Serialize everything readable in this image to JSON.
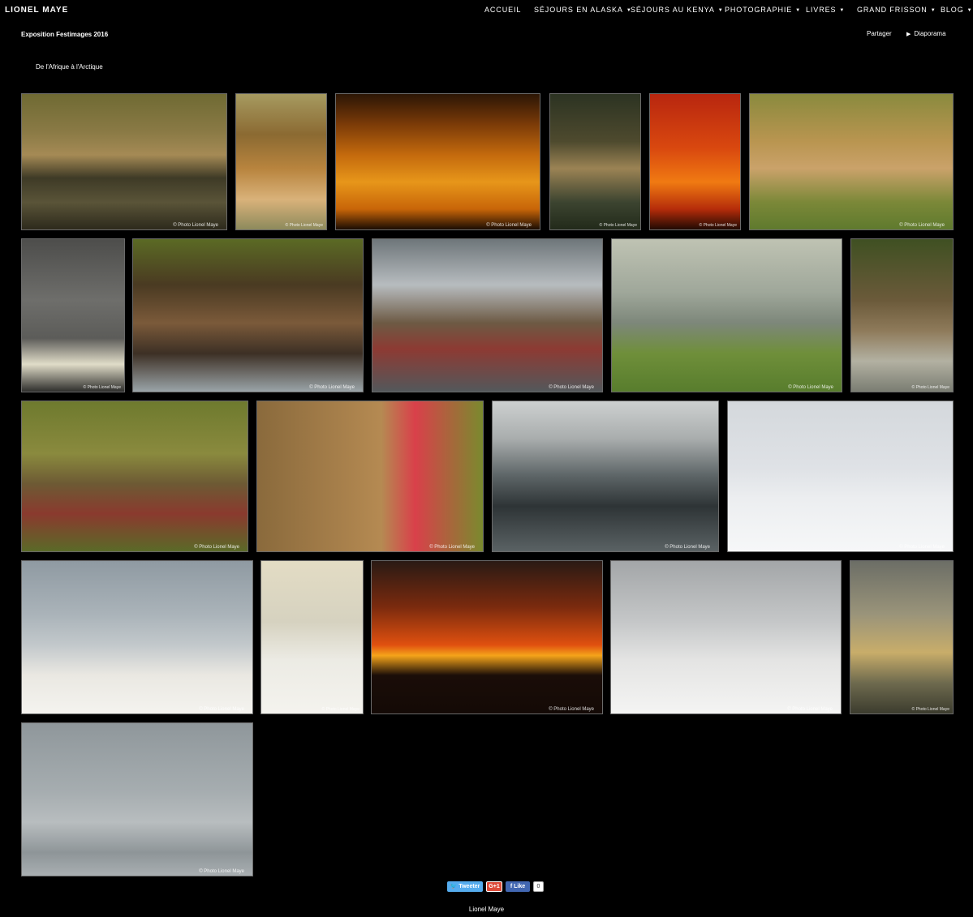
{
  "site": {
    "title": "LIONEL MAYE"
  },
  "nav": [
    {
      "label": "ACCUEIL",
      "caret": ""
    },
    {
      "label": "SÉJOURS EN ALASKA",
      "caret": "▼"
    },
    {
      "label": "SÉJOURS AU KENYA",
      "caret": "▼"
    },
    {
      "label": "PHOTOGRAPHIE",
      "caret": "▼"
    },
    {
      "label": "LIVRES",
      "caret": "▼"
    },
    {
      "label": "GRAND FRISSON",
      "caret": "▼"
    },
    {
      "label": "BLOG",
      "caret": "▼"
    }
  ],
  "gallery": {
    "title": "Exposition Festimages 2016",
    "subtitle": "De l'Afrique à l'Arctique",
    "share_label": "Partager",
    "slideshow_label": "Diaporama",
    "slideshow_icon": "play-icon",
    "watermark": "© Photo Lionel Maye",
    "photos": [
      {
        "name": "cheetahs-drinking",
        "bg": "linear-gradient(180deg,#6f6a33 0%,#8a7a45 28%,#a58a55 45%,#3e3a26 62%,#5a5438 80%,#2d2a1c 100%)"
      },
      {
        "name": "lion-roaring",
        "bg": "linear-gradient(180deg,#a69a60 0%,#8b6a32 30%,#b8843e 55%,#d9b27a 78%,#8d8a5c 100%)"
      },
      {
        "name": "elephant-sunset",
        "bg": "linear-gradient(180deg,#2c1605 0%,#7a3a08 22%,#c46a0d 45%,#e7961a 65%,#c86508 85%,#1a0c03 100%)"
      },
      {
        "name": "leopard-tree",
        "bg": "linear-gradient(180deg,#2c3322 0%,#4e4a2e 35%,#9b8354 55%,#3c4430 80%,#222a1a 100%)"
      },
      {
        "name": "giraffe-sunset",
        "bg": "linear-gradient(180deg,#b8260f 0%,#d9480f 40%,#f07a12 65%,#b52c0a 85%,#200a03 100%)"
      },
      {
        "name": "lion-cubs",
        "bg": "linear-gradient(180deg,#8a8a3e 0%,#b99550 35%,#caa26a 55%,#7b8838 80%,#5f7a2e 100%)"
      },
      {
        "name": "elephant-portrait",
        "bg": "linear-gradient(180deg,#4d4d4b 0%,#6e6e6b 40%,#5c5c59 65%,#e0dcc8 82%,#2e2e2c 100%)"
      },
      {
        "name": "bears-fighting",
        "bg": "linear-gradient(180deg,#5b6a24 0%,#4a3a22 30%,#7b5a3a 55%,#3d3025 75%,#9aa4a8 100%)"
      },
      {
        "name": "bear-splash",
        "bg": "linear-gradient(180deg,#6e767a 0%,#b7bcbf 30%,#6d5a44 55%,#8d3a33 72%,#53585b 100%)"
      },
      {
        "name": "bears-meadow",
        "bg": "linear-gradient(180deg,#bfc3b3 0%,#9fa79a 35%,#7d877a 55%,#6f8f3a 75%,#587d2d 100%)"
      },
      {
        "name": "bear-cub-branch",
        "bg": "linear-gradient(180deg,#3f5022 0%,#6b5a3a 40%,#8e7a5a 60%,#b3b1a2 80%,#7a7d72 100%)"
      },
      {
        "name": "bear-cubs-grass",
        "bg": "linear-gradient(180deg,#6e7a2e 0%,#8a8a3e 35%,#6d5a34 55%,#8a3a2e 75%,#5a6a28 100%)"
      },
      {
        "name": "bear-salmon",
        "bg": "linear-gradient(90deg,#8a6a3c 0%,#a57e4a 35%,#b58a52 55%,#d9404a 70%,#7a8a2e 100%)"
      },
      {
        "name": "bear-swimming",
        "bg": "linear-gradient(180deg,#cdd0d0 0%,#a9adad 25%,#5c6466 50%,#2e3436 70%,#5a6264 100%)"
      },
      {
        "name": "polar-cubs-sleeping",
        "bg": "linear-gradient(180deg,#d4d8dc 0%,#dfe2e6 45%,#eceef0 65%,#f6f7f8 100%)"
      },
      {
        "name": "polar-bears-playing",
        "bg": "linear-gradient(180deg,#8f9aa2 0%,#aab3b9 35%,#c2c8cb 55%,#eae8e2 75%,#f4f3ef 100%)"
      },
      {
        "name": "polar-mother-cub",
        "bg": "linear-gradient(180deg,#e3dcc4 0%,#d6d2c0 40%,#ecebe4 65%,#f4f3ee 100%)"
      },
      {
        "name": "polar-bears-sunset",
        "bg": "linear-gradient(180deg,#2a1a14 0%,#7a2a0e 30%,#e0500f 55%,#f5a41a 62%,#1a0d08 75%,#140a06 100%)"
      },
      {
        "name": "polar-bears-sparring",
        "bg": "linear-gradient(180deg,#a3a6a8 0%,#c5c7c8 40%,#e4e4e3 65%,#f4f4f3 100%)"
      },
      {
        "name": "polar-bear-water",
        "bg": "linear-gradient(180deg,#6c6e66 0%,#9a947a 35%,#c8ad6a 60%,#6e6a4e 80%,#3c3c2e 100%)"
      },
      {
        "name": "polar-bears-fog",
        "bg": "linear-gradient(180deg,#8f979b 0%,#a6adb0 45%,#b8bdbf 65%,#8e9598 85%,#a9afb2 100%)"
      }
    ]
  },
  "social": {
    "tweet_label": "Tweeter",
    "gplus_label": "G+1",
    "fb_label": "Like",
    "fb_count": "0"
  },
  "footer": {
    "text": "Lionel Maye"
  }
}
